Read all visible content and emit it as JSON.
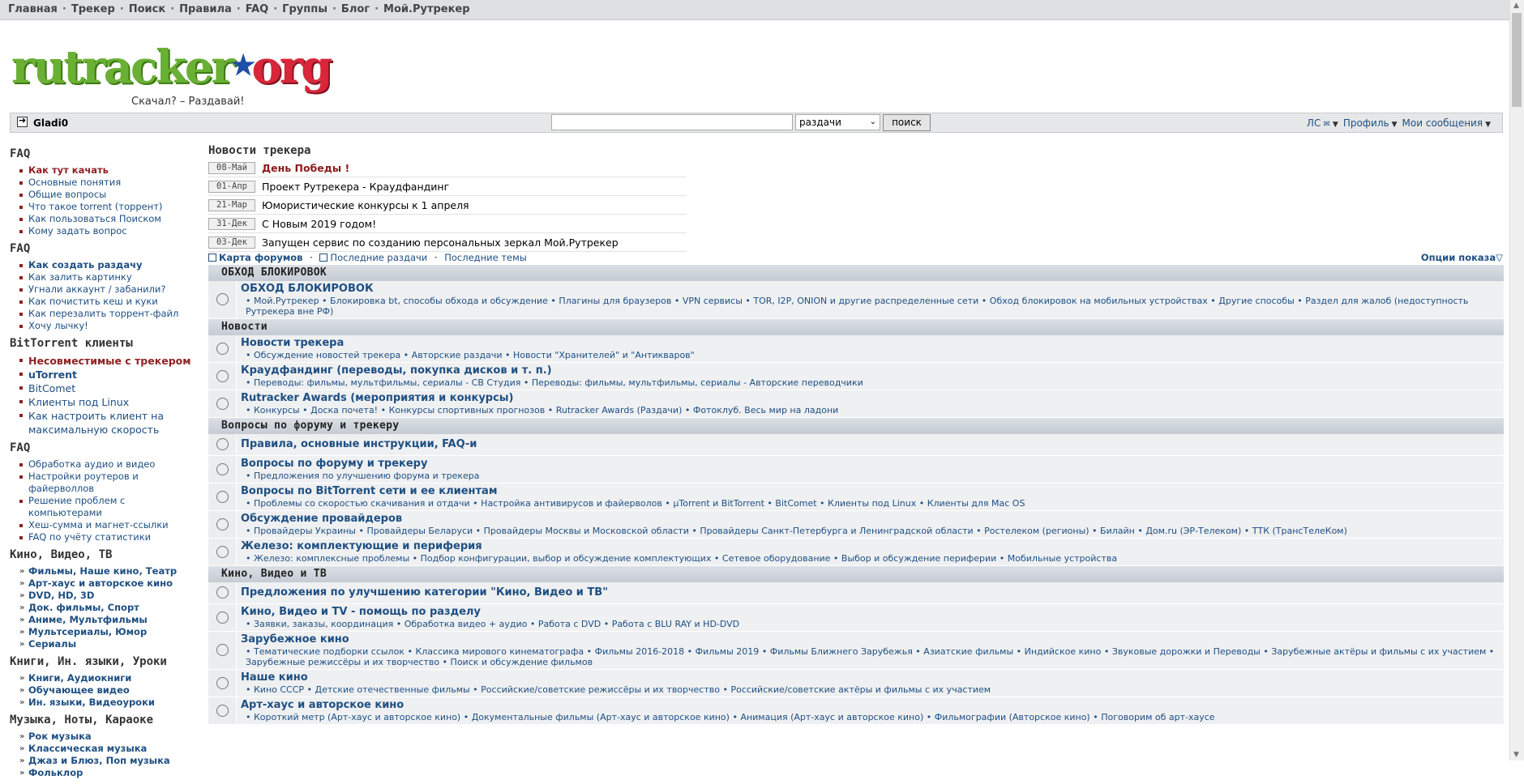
{
  "topnav": [
    "Главная",
    "Трекер",
    "Поиск",
    "Правила",
    "FAQ",
    "Группы",
    "Блог",
    "Мой.Рутрекер"
  ],
  "logo": {
    "part1": "rutracker",
    "part2": "org",
    "tagline": "Скачал? – Раздавай!"
  },
  "userbar": {
    "username": "Gladi0",
    "search_value": "",
    "search_select": "раздачи",
    "search_button": "поиск",
    "links": [
      "ЛС",
      "Профиль",
      "Мои сообщения"
    ]
  },
  "sidebar": [
    {
      "title": "FAQ",
      "style": "dot",
      "items": [
        {
          "label": "Как тут качать",
          "cls": "red"
        },
        {
          "label": "Основные понятия"
        },
        {
          "label": "Общие вопросы"
        },
        {
          "label": "Что такое torrent (торрент)"
        },
        {
          "label": "Как пользоваться Поиском"
        },
        {
          "label": "Кому задать вопрос"
        }
      ]
    },
    {
      "title": "FAQ",
      "style": "dot",
      "items": [
        {
          "label": "Как создать раздачу",
          "cls": "b"
        },
        {
          "label": "Как залить картинку"
        },
        {
          "label": "Угнали аккаунт / забанили?"
        },
        {
          "label": "Как почистить кеш и куки"
        },
        {
          "label": "Как перезалить торрент-файл"
        },
        {
          "label": "Хочу лычку!"
        }
      ]
    },
    {
      "title": "BitTorrent клиенты",
      "style": "dot",
      "items": [
        {
          "label": "Несовместимые с трекером",
          "cls": "red big"
        },
        {
          "label": "uTorrent",
          "cls": "big b"
        },
        {
          "label": "BitComet",
          "cls": "big"
        },
        {
          "label": "Клиенты под Linux",
          "cls": "big"
        },
        {
          "label": "Как настроить клиент на максимальную скорость",
          "cls": "big"
        }
      ]
    },
    {
      "title": "FAQ",
      "style": "dot",
      "items": [
        {
          "label": "Обработка аудио и видео"
        },
        {
          "label": "Настройки роутеров и файерволлов"
        },
        {
          "label": "Решение проблем с компьютерами"
        },
        {
          "label": "Хеш-сумма и магнет-ссылки"
        },
        {
          "label": "FAQ по учёту статистики"
        }
      ]
    },
    {
      "title": "Кино, Видео, ТВ",
      "style": "arrow",
      "items": [
        {
          "label": "Фильмы, Наше кино, Театр",
          "cls": "b"
        },
        {
          "label": "Арт-хаус и авторское кино",
          "cls": "b"
        },
        {
          "label": "DVD, HD, 3D",
          "cls": "b"
        },
        {
          "label": "Док. фильмы, Спорт",
          "cls": "b"
        },
        {
          "label": "Аниме, Мультфильмы",
          "cls": "b"
        },
        {
          "label": "Мультсериалы, Юмор",
          "cls": "b"
        },
        {
          "label": "Сериалы",
          "cls": "b"
        }
      ]
    },
    {
      "title": "Книги, Ин. языки, Уроки",
      "style": "arrow",
      "items": [
        {
          "label": "Книги, Аудиокниги",
          "cls": "b"
        },
        {
          "label": "Обучающее видео",
          "cls": "b"
        },
        {
          "label": "Ин. языки, Видеоуроки",
          "cls": "b"
        }
      ]
    },
    {
      "title": "Музыка, Ноты, Караоке",
      "style": "arrow",
      "items": [
        {
          "label": "Рок музыка",
          "cls": "b"
        },
        {
          "label": "Классическая музыка",
          "cls": "b"
        },
        {
          "label": "Джаз и Блюз, Поп музыка",
          "cls": "b"
        },
        {
          "label": "Фольклор",
          "cls": "b"
        }
      ]
    }
  ],
  "news": {
    "title": "Новости трекера",
    "items": [
      {
        "date": "08-Май",
        "text": "День Победы !",
        "hot": true
      },
      {
        "date": "01-Апр",
        "text": "Проект Рутрекера - Краудфандинг"
      },
      {
        "date": "21-Мар",
        "text": "Юмористические конкурсы к 1 апреля"
      },
      {
        "date": "31-Дек",
        "text": "С Новым 2019 годом!"
      },
      {
        "date": "03-Дек",
        "text": "Запущен сервис по созданию персональных зеркал Мой.Рутрекер"
      }
    ]
  },
  "forum_links": {
    "map": "Карта форумов",
    "latest_releases": "Последние раздачи",
    "latest_topics": "Последние темы",
    "view_options": "Опции показа"
  },
  "categories": [
    {
      "title": "ОБХОД БЛОКИРОВОК",
      "forums": [
        {
          "title": "ОБХОД БЛОКИРОВОК",
          "sub": [
            "Мой.Рутрекер",
            "Блокировка bt, способы обхода и обсуждение",
            "Плагины для браузеров",
            "VPN сервисы",
            "TOR, I2P, ONION и другие распределенные сети",
            "Обход блокировок на мобильных устройствах",
            "Другие способы",
            "Раздел для жалоб (недоступность Рутрекера вне РФ)"
          ]
        }
      ]
    },
    {
      "title": "Новости",
      "forums": [
        {
          "title": "Новости трекера",
          "sub": [
            "Обсуждение новостей трекера",
            "Авторские раздачи",
            "Новости \"Хранителей\" и \"Антикваров\""
          ]
        },
        {
          "title": "Краудфандинг (переводы, покупка дисков и т. п.)",
          "sub": [
            "Переводы: фильмы, мультфильмы, сериалы - СВ Студия",
            "Переводы: фильмы, мультфильмы, сериалы - Авторские переводчики"
          ]
        },
        {
          "title": "Rutracker Awards (мероприятия и конкурсы)",
          "sub": [
            "Конкурсы",
            "Доска почета!",
            "Конкурсы спортивных прогнозов",
            "Rutracker Awards (Раздачи)",
            "Фотоклуб. Весь мир на ладони"
          ]
        }
      ]
    },
    {
      "title": "Вопросы по форуму и трекеру",
      "forums": [
        {
          "title": "Правила, основные инструкции, FAQ-и",
          "sub": []
        },
        {
          "title": "Вопросы по форуму и трекеру",
          "sub": [
            "Предложения по улучшению форума и трекера"
          ]
        },
        {
          "title": "Вопросы по BitTorrent сети и ее клиентам",
          "sub": [
            "Проблемы со скоростью скачивания и отдачи",
            "Настройка антивирусов и файерволов",
            "µTorrent и BitTorrent",
            "BitComet",
            "Клиенты под Linux",
            "Клиенты для Mac OS"
          ]
        },
        {
          "title": "Обсуждение провайдеров",
          "sub": [
            "Провайдеры Украины",
            "Провайдеры Беларуси",
            "Провайдеры Москвы и Московской области",
            "Провайдеры Санкт-Петербурга и Ленинградской области",
            "Ростелеком (регионы)",
            "Билайн",
            "Дом.ru (ЭР-Телеком)",
            "ТТК (ТрансТелеКом)"
          ]
        },
        {
          "title": "Железо: комплектующие и периферия",
          "sub": [
            "Железо: комплексные проблемы",
            "Подбор конфигурации, выбор и обсуждение комплектующих",
            "Сетевое оборудование",
            "Выбор и обсуждение периферии",
            "Мобильные устройства"
          ]
        }
      ]
    },
    {
      "title": "Кино, Видео и ТВ",
      "forums": [
        {
          "title": "Предложения по улучшению категории \"Кино, Видео и ТВ\"",
          "sub": []
        },
        {
          "title": "Кино, Видео и TV - помощь по разделу",
          "sub": [
            "Заявки, заказы, координация",
            "Обработка видео + аудио",
            "Работа с DVD",
            "Работа с BLU RAY и HD-DVD"
          ]
        },
        {
          "title": "Зарубежное кино",
          "sub": [
            "Тематические подборки ссылок",
            "Классика мирового кинематографа",
            "Фильмы 2016-2018",
            "Фильмы 2019",
            "Фильмы Ближнего Зарубежья",
            "Азиатские фильмы",
            "Индийское кино",
            "Звуковые дорожки и Переводы",
            "Зарубежные актёры и фильмы с их участием",
            "Зарубежные режиссёры и их творчество",
            "Поиск и обсуждение фильмов"
          ]
        },
        {
          "title": "Наше кино",
          "sub": [
            "Кино СССР",
            "Детские отечественные фильмы",
            "Российские/советские режиссёры и их творчество",
            "Российские/советские актёры и фильмы с их участием"
          ]
        },
        {
          "title": "Арт-хаус и авторское кино",
          "sub": [
            "Короткий метр (Арт-хаус и авторское кино)",
            "Документальные фильмы (Арт-хаус и авторское кино)",
            "Анимация (Арт-хаус и авторское кино)",
            "Фильмографии (Авторское кино)",
            "Поговорим об арт-хаусе"
          ]
        }
      ]
    }
  ]
}
